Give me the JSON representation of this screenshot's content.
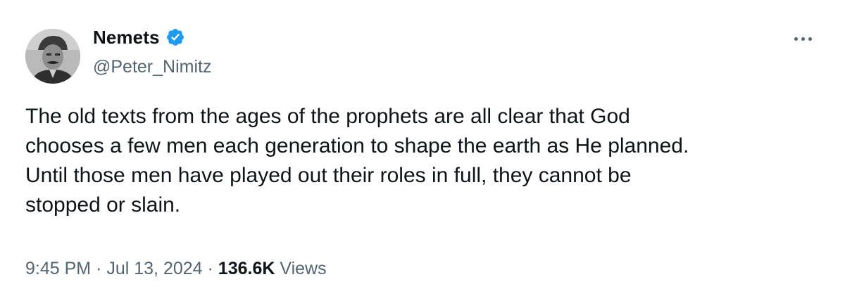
{
  "author": {
    "display_name": "Nemets",
    "handle": "@Peter_Nimitz",
    "verified": true,
    "verified_color": "#1d9bf0"
  },
  "tweet": {
    "text_lines": [
      "The old texts from the ages of the prophets are all clear that God",
      "chooses a few men each generation to shape the earth as He planned.",
      "Until those men have played out their roles in full, they cannot be",
      "stopped or slain."
    ],
    "time": "9:45 PM",
    "date": "Jul 13, 2024",
    "separator": "·",
    "views_count": "136.6K",
    "views_label": "Views"
  },
  "icons": {
    "more": "more-horizontal-icon",
    "verified": "verified-badge-icon"
  },
  "colors": {
    "text": "#0f1419",
    "secondary": "#536471"
  }
}
